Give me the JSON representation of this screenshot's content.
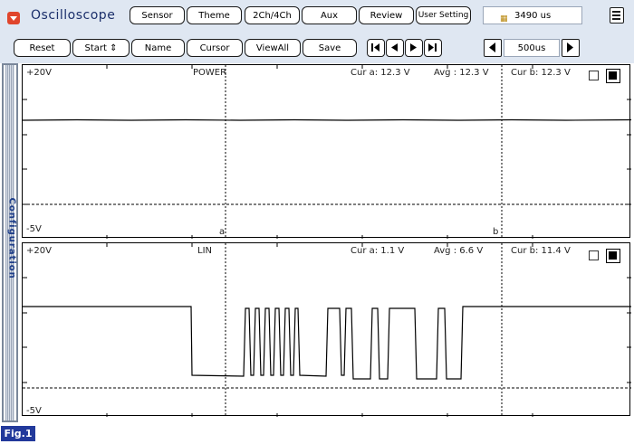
{
  "app": {
    "title": "Oscilloscope",
    "fig_label": "Fig.1"
  },
  "toolbar_top": {
    "sensor": "Sensor",
    "theme": "Theme",
    "channels": "2Ch/4Ch",
    "aux": "Aux",
    "review": "Review",
    "user_setting": "User Setting",
    "time_value": "3490 us"
  },
  "toolbar_bottom": {
    "reset": "Reset",
    "start": "Start ⇕",
    "name": "Name",
    "cursor": "Cursor",
    "viewall": "ViewAll",
    "save": "Save",
    "timebase": "500us"
  },
  "sidebar": {
    "label": "Configuration"
  },
  "channels": [
    {
      "name": "POWER",
      "top_label": "+20V",
      "bottom_label": "-5V",
      "cur_a": "Cur a: 12.3 V",
      "avg": "Avg : 12.3 V",
      "cur_b": "Cur b: 12.3 V",
      "cursor_a": "a",
      "cursor_b": "b"
    },
    {
      "name": "LIN",
      "top_label": "+20V",
      "bottom_label": "-5V",
      "cur_a": "Cur a: 1.1 V",
      "avg": "Avg : 6.6 V",
      "cur_b": "Cur b: 11.4 V"
    }
  ],
  "colors": {
    "toolbar_bg": "#dfe7f2",
    "logo": "#e0452c",
    "fig_label_bg": "#22399b",
    "title": "#1b2f6b"
  }
}
